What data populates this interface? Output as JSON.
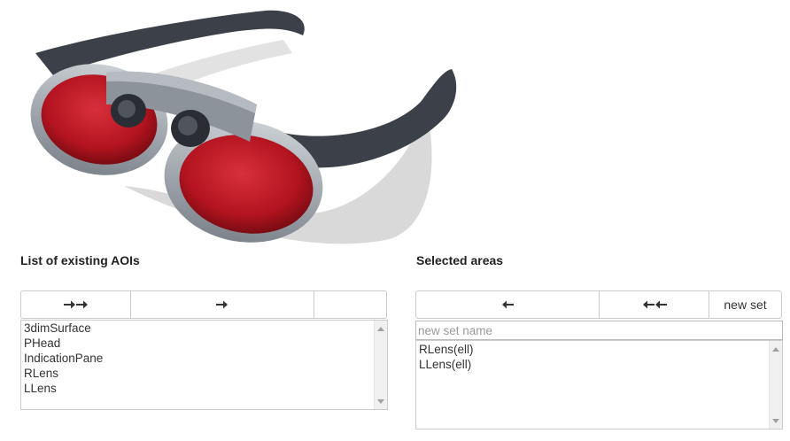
{
  "illustration": {
    "icon": "eye-tracking-glasses-illustration"
  },
  "left_panel": {
    "heading": "List of existing AOIs",
    "buttons": [
      {
        "icon": "double-arrow-right-icon",
        "label": ""
      },
      {
        "icon": "arrow-right-icon",
        "label": ""
      },
      {
        "icon": "",
        "label": ""
      }
    ],
    "items": [
      "3dimSurface",
      "PHead",
      "IndicationPane",
      "RLens",
      "LLens"
    ]
  },
  "right_panel": {
    "heading": "Selected areas",
    "buttons": [
      {
        "icon": "arrow-left-icon",
        "label": ""
      },
      {
        "icon": "double-arrow-left-icon",
        "label": ""
      },
      {
        "icon": "",
        "label": "new set"
      }
    ],
    "set_name": {
      "value": "",
      "placeholder": "new set name"
    },
    "items": [
      "RLens(ell)",
      "LLens(ell)"
    ]
  },
  "colors": {
    "lens_red": "#b3141f",
    "frame_gray": "#8c939b",
    "frame_dark": "#3c4048",
    "border": "#cccccc"
  }
}
